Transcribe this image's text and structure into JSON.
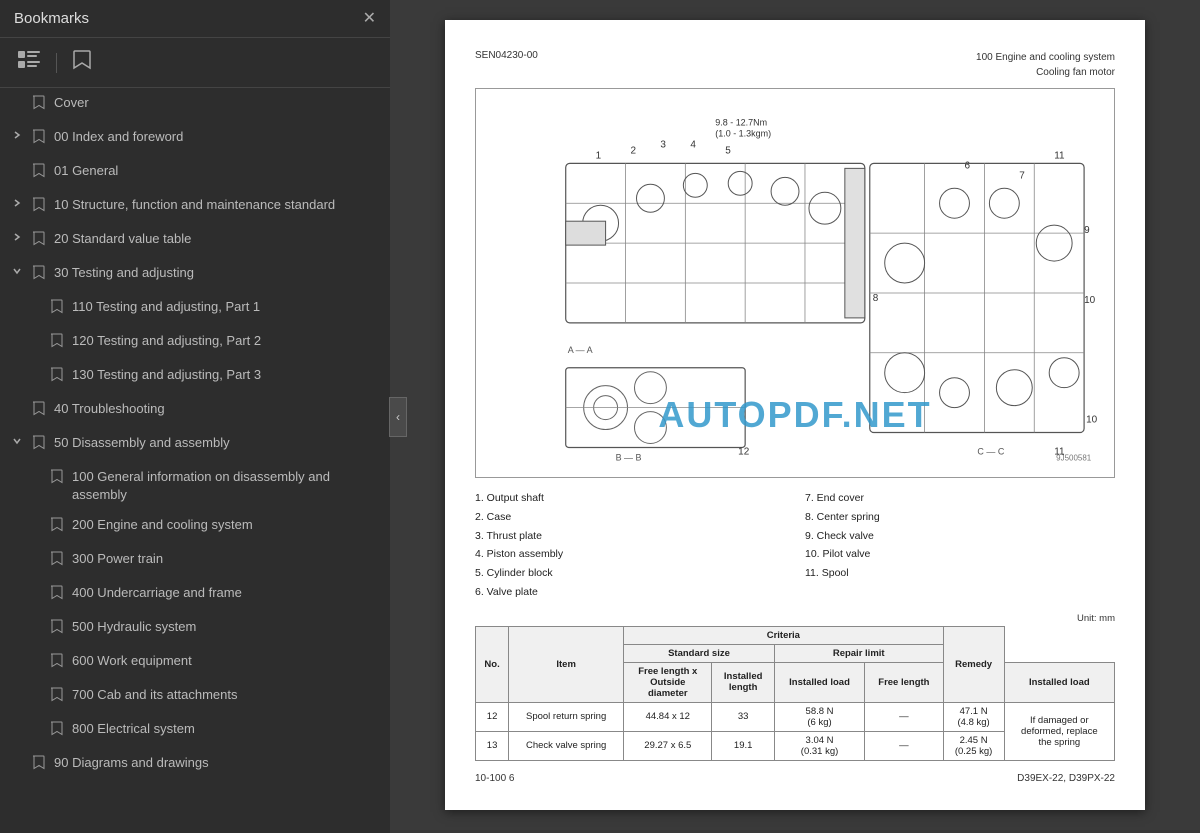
{
  "sidebar": {
    "title": "Bookmarks",
    "close_label": "✕",
    "toolbar": {
      "view_icon": "☰",
      "bookmark_icon": "🔖"
    },
    "items": [
      {
        "id": "cover",
        "label": "Cover",
        "level": 0,
        "expanded": false,
        "hasChildren": false,
        "active": false
      },
      {
        "id": "00",
        "label": "00 Index and foreword",
        "level": 0,
        "expanded": false,
        "hasChildren": true,
        "active": false
      },
      {
        "id": "01",
        "label": "01 General",
        "level": 0,
        "expanded": false,
        "hasChildren": false,
        "active": false
      },
      {
        "id": "10",
        "label": "10 Structure, function and maintenance standard",
        "level": 0,
        "expanded": false,
        "hasChildren": true,
        "active": false
      },
      {
        "id": "20",
        "label": "20 Standard value table",
        "level": 0,
        "expanded": false,
        "hasChildren": true,
        "active": false
      },
      {
        "id": "30",
        "label": "30 Testing and adjusting",
        "level": 0,
        "expanded": true,
        "hasChildren": true,
        "active": false
      },
      {
        "id": "110",
        "label": "110 Testing and adjusting, Part 1",
        "level": 1,
        "expanded": false,
        "hasChildren": false,
        "active": false
      },
      {
        "id": "120",
        "label": "120 Testing and adjusting, Part 2",
        "level": 1,
        "expanded": false,
        "hasChildren": false,
        "active": false
      },
      {
        "id": "130",
        "label": "130 Testing and adjusting, Part 3",
        "level": 1,
        "expanded": false,
        "hasChildren": false,
        "active": false
      },
      {
        "id": "40",
        "label": "40 Troubleshooting",
        "level": 0,
        "expanded": false,
        "hasChildren": false,
        "active": false
      },
      {
        "id": "50",
        "label": "50 Disassembly and assembly",
        "level": 0,
        "expanded": true,
        "hasChildren": true,
        "active": false
      },
      {
        "id": "100sub",
        "label": "100 General information on disassembly and assembly",
        "level": 1,
        "expanded": false,
        "hasChildren": false,
        "active": false
      },
      {
        "id": "200",
        "label": "200 Engine and cooling system",
        "level": 1,
        "expanded": false,
        "hasChildren": false,
        "active": false
      },
      {
        "id": "300",
        "label": "300 Power train",
        "level": 1,
        "expanded": false,
        "hasChildren": false,
        "active": false
      },
      {
        "id": "400",
        "label": "400 Undercarriage and frame",
        "level": 1,
        "expanded": false,
        "hasChildren": false,
        "active": false
      },
      {
        "id": "500",
        "label": "500 Hydraulic system",
        "level": 1,
        "expanded": false,
        "hasChildren": false,
        "active": false
      },
      {
        "id": "600",
        "label": "600 Work equipment",
        "level": 1,
        "expanded": false,
        "hasChildren": false,
        "active": false
      },
      {
        "id": "700",
        "label": "700 Cab and its attachments",
        "level": 1,
        "expanded": false,
        "hasChildren": false,
        "active": false
      },
      {
        "id": "800",
        "label": "800 Electrical system",
        "level": 1,
        "expanded": false,
        "hasChildren": false,
        "active": false
      },
      {
        "id": "90",
        "label": "90 Diagrams and drawings",
        "level": 0,
        "expanded": false,
        "hasChildren": false,
        "active": false
      }
    ]
  },
  "doc": {
    "ref_code": "SEN04230-00",
    "header_right_line1": "100 Engine and cooling system",
    "header_right_line2": "Cooling fan motor",
    "parts": [
      "1. Output shaft",
      "7. End cover",
      "2. Case",
      "8. Center spring",
      "3. Thrust plate",
      "9. Check valve",
      "4. Piston assembly",
      "10. Pilot valve",
      "5. Cylinder block",
      "11. Spool",
      "6. Valve plate",
      ""
    ],
    "unit_label": "Unit: mm",
    "table": {
      "headers": [
        "No.",
        "Item",
        "Criteria",
        "",
        "",
        "",
        "Remedy"
      ],
      "subheaders": [
        "",
        "",
        "Standard size",
        "",
        "Repair limit",
        "",
        ""
      ],
      "subsubheaders": [
        "",
        "",
        "Free length x Outside diameter",
        "Installed length",
        "Installed load",
        "Free length",
        "Installed load",
        ""
      ],
      "rows": [
        {
          "no": "12",
          "item": "Spool return spring",
          "free_length_x_od": "44.84 x 12",
          "installed_length": "33",
          "installed_load_std": "58.8 N\n(6 kg)",
          "free_length_repair": "—",
          "installed_load_repair": "47.1 N\n(4.8 kg)",
          "remedy": "If damaged or\ndeformed, replace\nthe spring"
        },
        {
          "no": "13",
          "item": "Check valve spring",
          "free_length_x_od": "29.27 x 6.5",
          "installed_length": "19.1",
          "installed_load_std": "3.04 N\n(0.31 kg)",
          "free_length_repair": "—",
          "installed_load_repair": "2.45 N\n(0.25 kg)",
          "remedy": ""
        }
      ]
    },
    "footer_left": "10-100  6",
    "footer_right": "D39EX-22, D39PX-22"
  },
  "watermark": "AUTOPDF.NET"
}
